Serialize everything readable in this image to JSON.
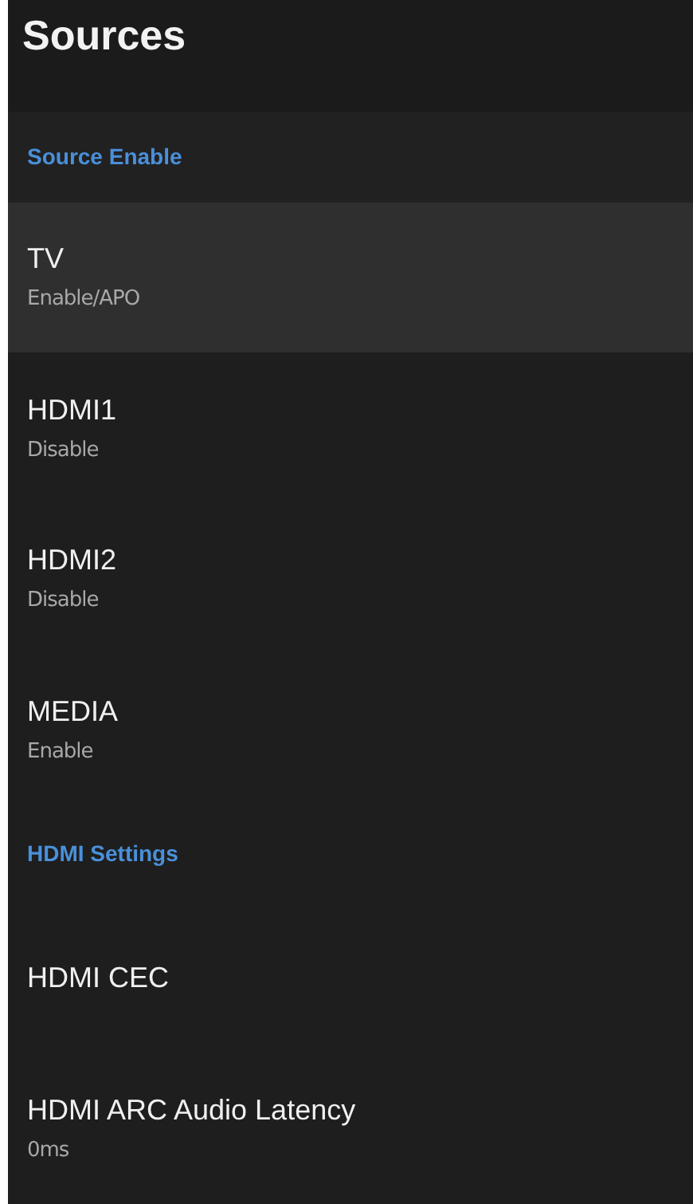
{
  "title": "Sources",
  "sections": [
    {
      "header": "Source Enable",
      "items": [
        {
          "title": "TV",
          "subtitle": "Enable/APO",
          "selected": true
        },
        {
          "title": "HDMI1",
          "subtitle": "Disable",
          "selected": false
        },
        {
          "title": "HDMI2",
          "subtitle": "Disable",
          "selected": false
        },
        {
          "title": "MEDIA",
          "subtitle": "Enable",
          "selected": false
        }
      ]
    },
    {
      "header": "HDMI Settings",
      "items": [
        {
          "title": "HDMI CEC",
          "selected": false
        },
        {
          "title": "HDMI ARC Audio Latency",
          "subtitle": "0ms",
          "selected": false
        }
      ]
    }
  ]
}
